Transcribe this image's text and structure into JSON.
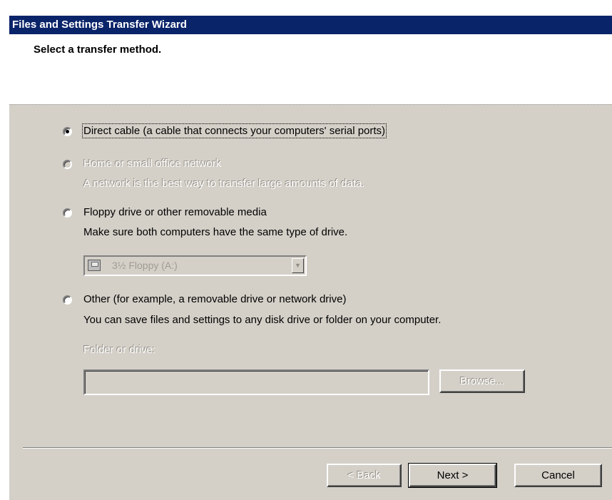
{
  "window": {
    "title": "Files and Settings Transfer Wizard"
  },
  "page": {
    "title": "Select a transfer method."
  },
  "options": [
    {
      "label": "Direct cable (a cable that connects your computers' serial ports)",
      "description": "",
      "selected": true,
      "enabled": true
    },
    {
      "label": "Home or small office network",
      "description": "A network is the best way to transfer large amounts of data.",
      "selected": false,
      "enabled": false
    },
    {
      "label": "Floppy drive or other removable media",
      "description": "Make sure both computers have the same type of drive.",
      "selected": false,
      "enabled": true
    },
    {
      "label": "Other (for example, a removable drive or network drive)",
      "description": "You can save files and settings to any disk drive or folder on your computer.",
      "selected": false,
      "enabled": true
    }
  ],
  "drive_select": {
    "value": "3½ Floppy (A:)",
    "icon": "floppy-drive-icon",
    "enabled": false
  },
  "folder": {
    "label": "Folder or drive:",
    "value": "",
    "browse_label": "Browse...",
    "enabled": false
  },
  "buttons": {
    "back": "< Back",
    "next": "Next >",
    "cancel": "Cancel"
  },
  "colors": {
    "titlebar": "#0a246a",
    "face": "#d4d0c8",
    "header": "#ffffff"
  }
}
